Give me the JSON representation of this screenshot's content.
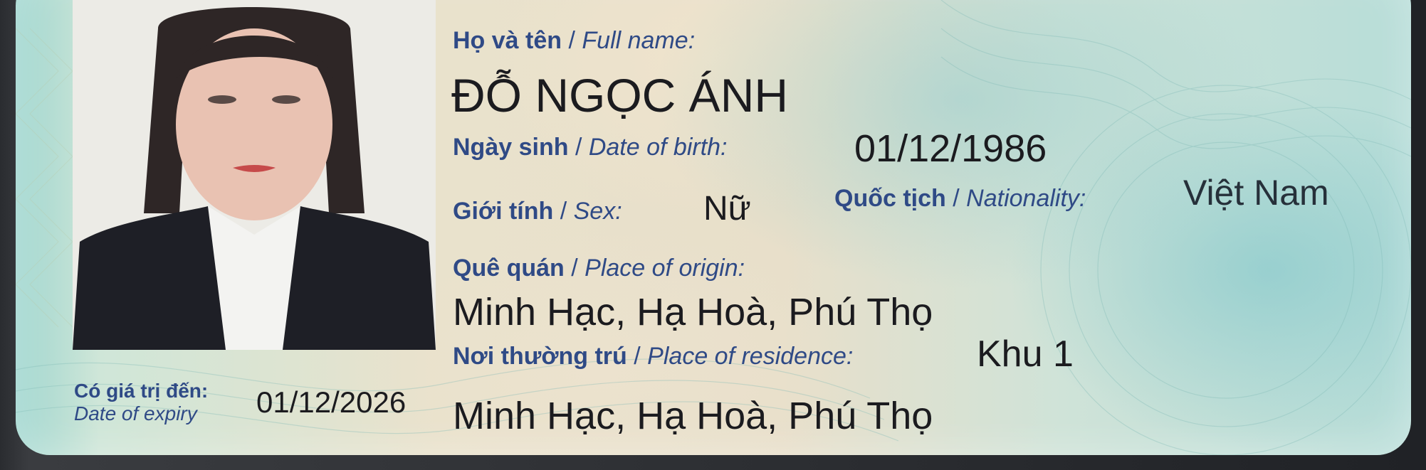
{
  "card": {
    "full_name_label_vn": "Họ và tên",
    "full_name_label_en": "Full name:",
    "full_name": "ĐỖ NGỌC ÁNH",
    "dob_label_vn": "Ngày sinh",
    "dob_label_en": "Date of birth:",
    "dob": "01/12/1986",
    "sex_label_vn": "Giới tính",
    "sex_label_en": "Sex:",
    "sex": "Nữ",
    "nationality_label_vn": "Quốc tịch",
    "nationality_label_en": "Nationality:",
    "nationality": "Việt Nam",
    "origin_label_vn": "Quê quán",
    "origin_label_en": "Place of origin:",
    "origin": "Minh Hạc, Hạ Hoà, Phú Thọ",
    "residence_label_vn": "Nơi thường trú",
    "residence_label_en": "Place of residence:",
    "residence_line1": "Khu 1",
    "residence_line2": "Minh Hạc, Hạ Hoà, Phú Thọ",
    "expiry_label_vn": "Có giá trị đến:",
    "expiry_label_en": "Date of expiry",
    "expiry": "01/12/2026",
    "separator": "/"
  }
}
